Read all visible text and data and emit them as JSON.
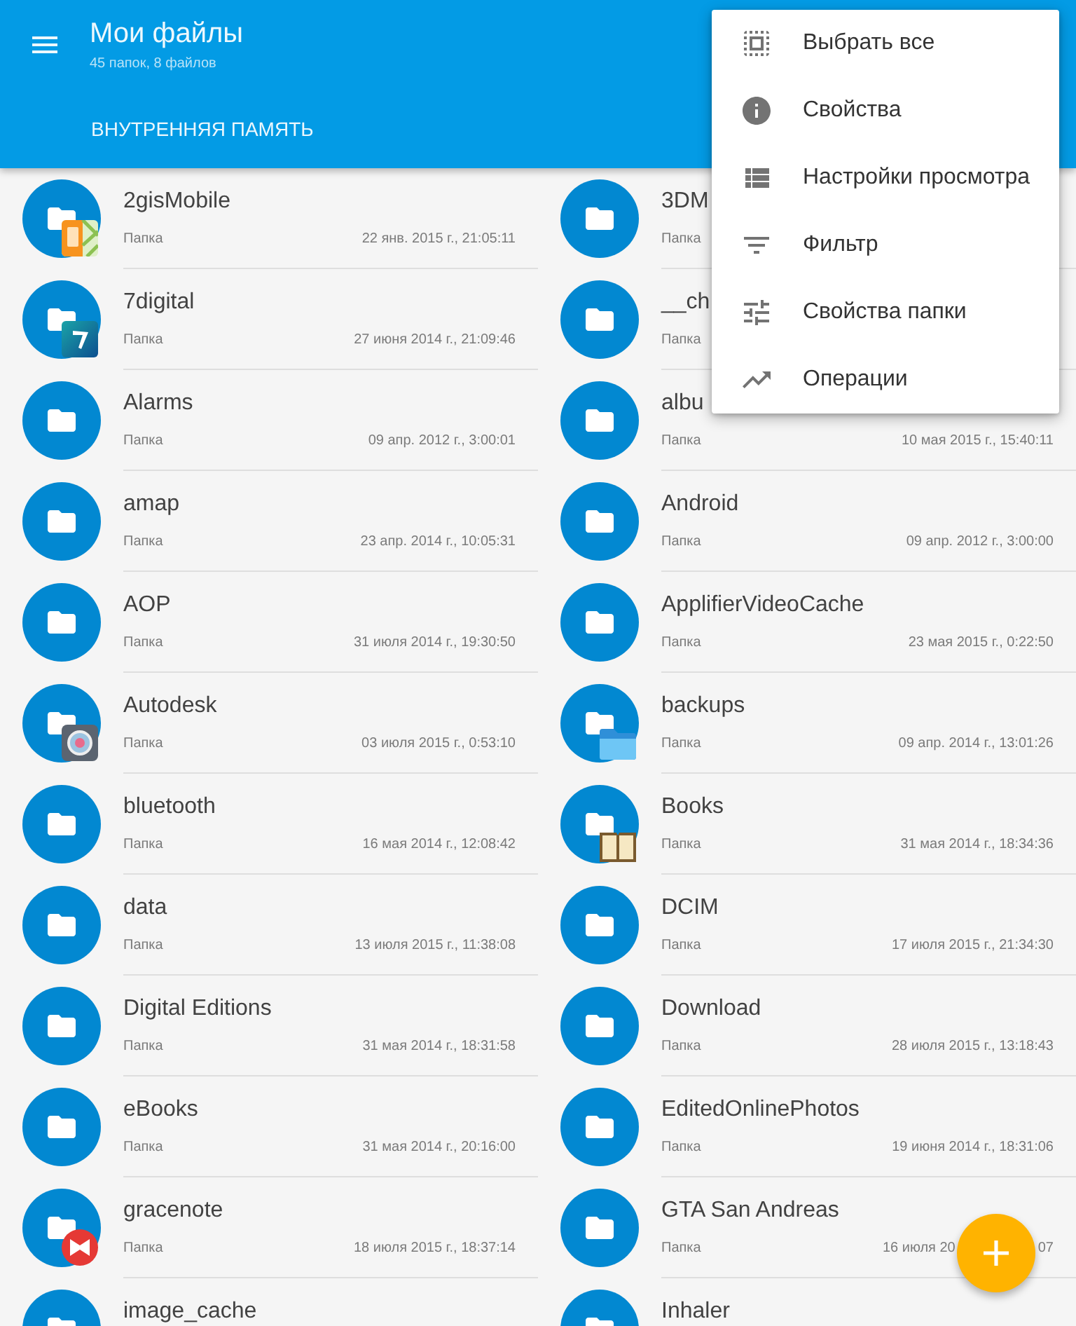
{
  "app_bar": {
    "title": "Мои файлы",
    "subtitle": "45 папок, 8 файлов",
    "tab": "ВНУТРЕННЯЯ ПАМЯТЬ"
  },
  "folders": [
    {
      "kind": "map",
      "name": "2gisMobile",
      "type": "Папка",
      "date": "22 янв. 2015 г., 21:05:11"
    },
    {
      "kind": "plain",
      "name": "3DM",
      "type": "Папка"
    },
    {
      "kind": "tile",
      "name": "7digital",
      "type": "Папка",
      "date": "27 июня 2014 г., 21:09:46"
    },
    {
      "kind": "plain",
      "name": "__ch",
      "type": "Папка"
    },
    {
      "kind": "plain",
      "name": "Alarms",
      "type": "Папка",
      "date": "09 апр. 2012 г., 3:00:01"
    },
    {
      "kind": "plain",
      "name": "albu",
      "type": "Папка",
      "date": "10 мая 2015 г., 15:40:11"
    },
    {
      "kind": "plain",
      "name": "amap",
      "type": "Папка",
      "date": "23 апр. 2014 г., 10:05:31"
    },
    {
      "kind": "plain",
      "name": "Android",
      "type": "Папка",
      "date": "09 апр. 2012 г., 3:00:00"
    },
    {
      "kind": "plain",
      "name": "AOP",
      "type": "Папка",
      "date": "31 июля 2014 г., 19:30:50"
    },
    {
      "kind": "plain",
      "name": "ApplifierVideoCache",
      "type": "Папка",
      "date": "23 мая 2015 г., 0:22:50"
    },
    {
      "kind": "lens",
      "name": "Autodesk",
      "type": "Папка",
      "date": "03 июля 2015 г., 0:53:10"
    },
    {
      "kind": "files",
      "name": "backups",
      "type": "Папка",
      "date": "09 апр. 2014 г., 13:01:26"
    },
    {
      "kind": "plain",
      "name": "bluetooth",
      "type": "Папка",
      "date": "16 мая 2014 г., 12:08:42"
    },
    {
      "kind": "book",
      "name": "Books",
      "type": "Папка",
      "date": "31 мая 2014 г., 18:34:36"
    },
    {
      "kind": "plain",
      "name": "data",
      "type": "Папка",
      "date": "13 июля 2015 г., 11:38:08"
    },
    {
      "kind": "plain",
      "name": "DCIM",
      "type": "Папка",
      "date": "17 июля 2015 г., 21:34:30"
    },
    {
      "kind": "plain",
      "name": "Digital Editions",
      "type": "Папка",
      "date": "31 мая 2014 г., 18:31:58"
    },
    {
      "kind": "plain",
      "name": "Download",
      "type": "Папка",
      "date": "28 июля 2015 г., 13:18:43"
    },
    {
      "kind": "plain",
      "name": "eBooks",
      "type": "Папка",
      "date": "31 мая 2014 г., 20:16:00"
    },
    {
      "kind": "plain",
      "name": "EditedOnlinePhotos",
      "type": "Папка",
      "date": "19 июня 2014 г., 18:31:06"
    },
    {
      "kind": "bowtie",
      "name": "gracenote",
      "type": "Папка",
      "date": "18 июля 2015 г., 18:37:14"
    },
    {
      "kind": "plain",
      "name": "GTA San Andreas",
      "type": "Папка",
      "date": "16 июля 20",
      "date_tail": "07"
    },
    {
      "kind": "plain",
      "name": "image_cache"
    },
    {
      "kind": "plain",
      "name": "Inhaler"
    }
  ],
  "menu": {
    "items": [
      "Выбрать все",
      "Свойства",
      "Настройки просмотра",
      "Фильтр",
      "Свойства папки",
      "Операции"
    ]
  }
}
